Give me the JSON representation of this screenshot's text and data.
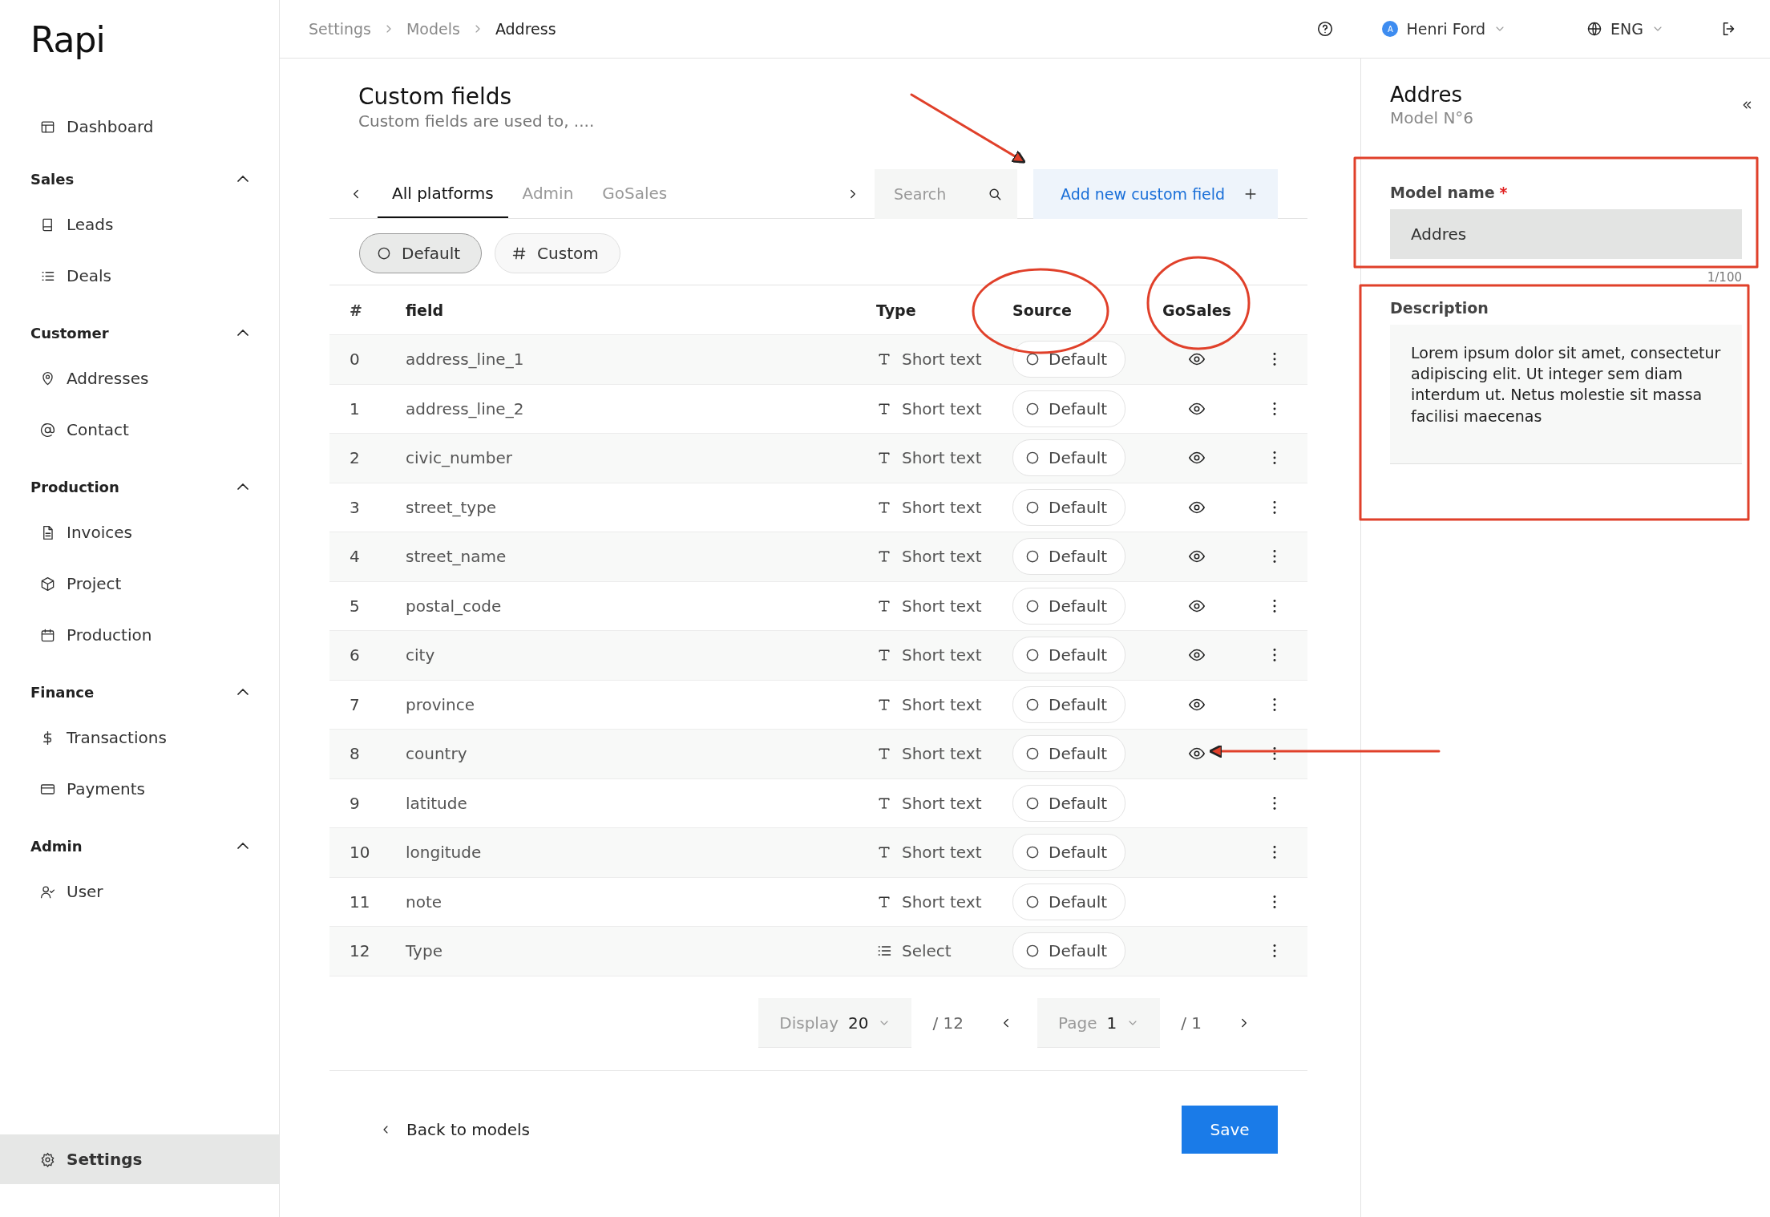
{
  "logo": "Rapi",
  "sidebar": {
    "items": [
      {
        "kind": "link",
        "label": "Dashboard",
        "selected": false
      },
      {
        "kind": "group",
        "label": "Sales",
        "expanded": true,
        "children": [
          {
            "label": "Leads",
            "selected": false
          },
          {
            "label": "Deals",
            "selected": false
          }
        ]
      },
      {
        "kind": "group",
        "label": "Customer",
        "expanded": true,
        "children": [
          {
            "label": "Addresses",
            "selected": false
          },
          {
            "label": "Contact",
            "selected": false
          }
        ]
      },
      {
        "kind": "group",
        "label": "Production",
        "expanded": true,
        "children": [
          {
            "label": "Invoices",
            "selected": false
          },
          {
            "label": "Project",
            "selected": false
          },
          {
            "label": "Production",
            "selected": false
          }
        ]
      },
      {
        "kind": "group",
        "label": "Finance",
        "expanded": true,
        "children": [
          {
            "label": "Transactions",
            "selected": false
          },
          {
            "label": "Payments",
            "selected": false
          }
        ]
      },
      {
        "kind": "group",
        "label": "Admin",
        "expanded": true,
        "children": [
          {
            "label": "User",
            "selected": false
          }
        ]
      }
    ],
    "footer_item": {
      "label": "Settings",
      "selected": true
    }
  },
  "breadcrumb": [
    "Settings",
    "Models",
    "Address"
  ],
  "topbar": {
    "user": {
      "initial": "A",
      "name": "Henri Ford"
    },
    "language": "ENG"
  },
  "page": {
    "title": "Custom fields",
    "subtitle": "Custom fields are used to, ...."
  },
  "tabs": [
    {
      "label": "All platforms",
      "selected": true
    },
    {
      "label": "Admin",
      "selected": false
    },
    {
      "label": "GoSales",
      "selected": false
    }
  ],
  "search": {
    "placeholder": "Search"
  },
  "add_button": "Add new custom field",
  "filters": [
    {
      "label": "Default",
      "selected": true
    },
    {
      "label": "Custom",
      "selected": false
    }
  ],
  "table": {
    "columns": [
      "#",
      "field",
      "Type",
      "Source",
      "GoSales"
    ],
    "rows": [
      {
        "index": "0",
        "field": "address_line_1",
        "type": {
          "kind": "text",
          "label": "Short text"
        },
        "source": "Default",
        "gosales_visible": true
      },
      {
        "index": "1",
        "field": "address_line_2",
        "type": {
          "kind": "text",
          "label": "Short text"
        },
        "source": "Default",
        "gosales_visible": true
      },
      {
        "index": "2",
        "field": "civic_number",
        "type": {
          "kind": "text",
          "label": "Short text"
        },
        "source": "Default",
        "gosales_visible": true
      },
      {
        "index": "3",
        "field": "street_type",
        "type": {
          "kind": "text",
          "label": "Short text"
        },
        "source": "Default",
        "gosales_visible": true
      },
      {
        "index": "4",
        "field": "street_name",
        "type": {
          "kind": "text",
          "label": "Short text"
        },
        "source": "Default",
        "gosales_visible": true
      },
      {
        "index": "5",
        "field": "postal_code",
        "type": {
          "kind": "text",
          "label": "Short text"
        },
        "source": "Default",
        "gosales_visible": true
      },
      {
        "index": "6",
        "field": "city",
        "type": {
          "kind": "text",
          "label": "Short text"
        },
        "source": "Default",
        "gosales_visible": true
      },
      {
        "index": "7",
        "field": "province",
        "type": {
          "kind": "text",
          "label": "Short text"
        },
        "source": "Default",
        "gosales_visible": true
      },
      {
        "index": "8",
        "field": "country",
        "type": {
          "kind": "text",
          "label": "Short text"
        },
        "source": "Default",
        "gosales_visible": true
      },
      {
        "index": "9",
        "field": "latitude",
        "type": {
          "kind": "text",
          "label": "Short text"
        },
        "source": "Default",
        "gosales_visible": false
      },
      {
        "index": "10",
        "field": "longitude",
        "type": {
          "kind": "text",
          "label": "Short text"
        },
        "source": "Default",
        "gosales_visible": false
      },
      {
        "index": "11",
        "field": "note",
        "type": {
          "kind": "text",
          "label": "Short text"
        },
        "source": "Default",
        "gosales_visible": false
      },
      {
        "index": "12",
        "field": "Type",
        "type": {
          "kind": "select",
          "label": "Select"
        },
        "source": "Default",
        "gosales_visible": false
      }
    ]
  },
  "pagination": {
    "display_label": "Display",
    "display_value": "20",
    "total": "/ 12",
    "page_label": "Page",
    "page_value": "1",
    "pages": "/ 1"
  },
  "footer": {
    "back": "Back to models",
    "save": "Save"
  },
  "panel": {
    "title": "Addres",
    "subtitle": "Model N°6",
    "model_name": {
      "label": "Model name",
      "required_mark": "*",
      "value": "Addres",
      "counter": "1/100"
    },
    "description": {
      "label": "Description",
      "value": "Lorem ipsum dolor sit amet, consectetur adipiscing elit. Ut integer sem diam interdum ut. Netus molestie sit massa facilisi maecenas"
    }
  }
}
